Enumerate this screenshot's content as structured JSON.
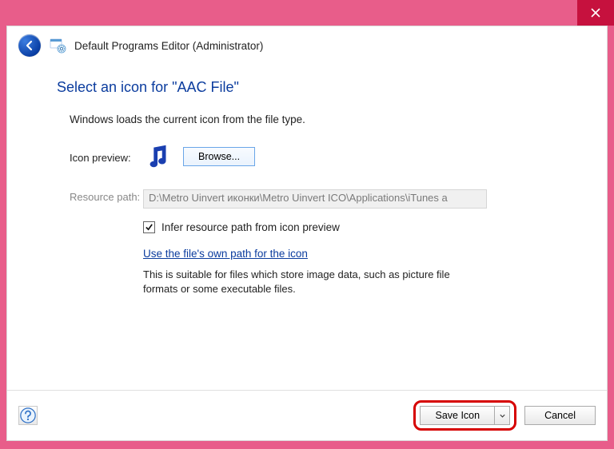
{
  "window": {
    "title": "Default Programs Editor (Administrator)"
  },
  "heading": "Select an icon for \"AAC File\"",
  "description": "Windows loads the current icon from the file type.",
  "labels": {
    "icon_preview": "Icon preview:",
    "resource_path": "Resource path:"
  },
  "browse_label": "Browse...",
  "resource_path_value": "D:\\Metro Uinvert иконки\\Metro Uinvert ICO\\Applications\\iTunes a",
  "infer_checkbox": {
    "checked": true,
    "label": "Infer resource path from icon preview"
  },
  "own_path_link": "Use the file's own path for the icon",
  "own_path_desc": "This is suitable for files which store image data, such as picture file formats or some executable files.",
  "footer": {
    "save_label": "Save Icon",
    "cancel_label": "Cancel"
  }
}
